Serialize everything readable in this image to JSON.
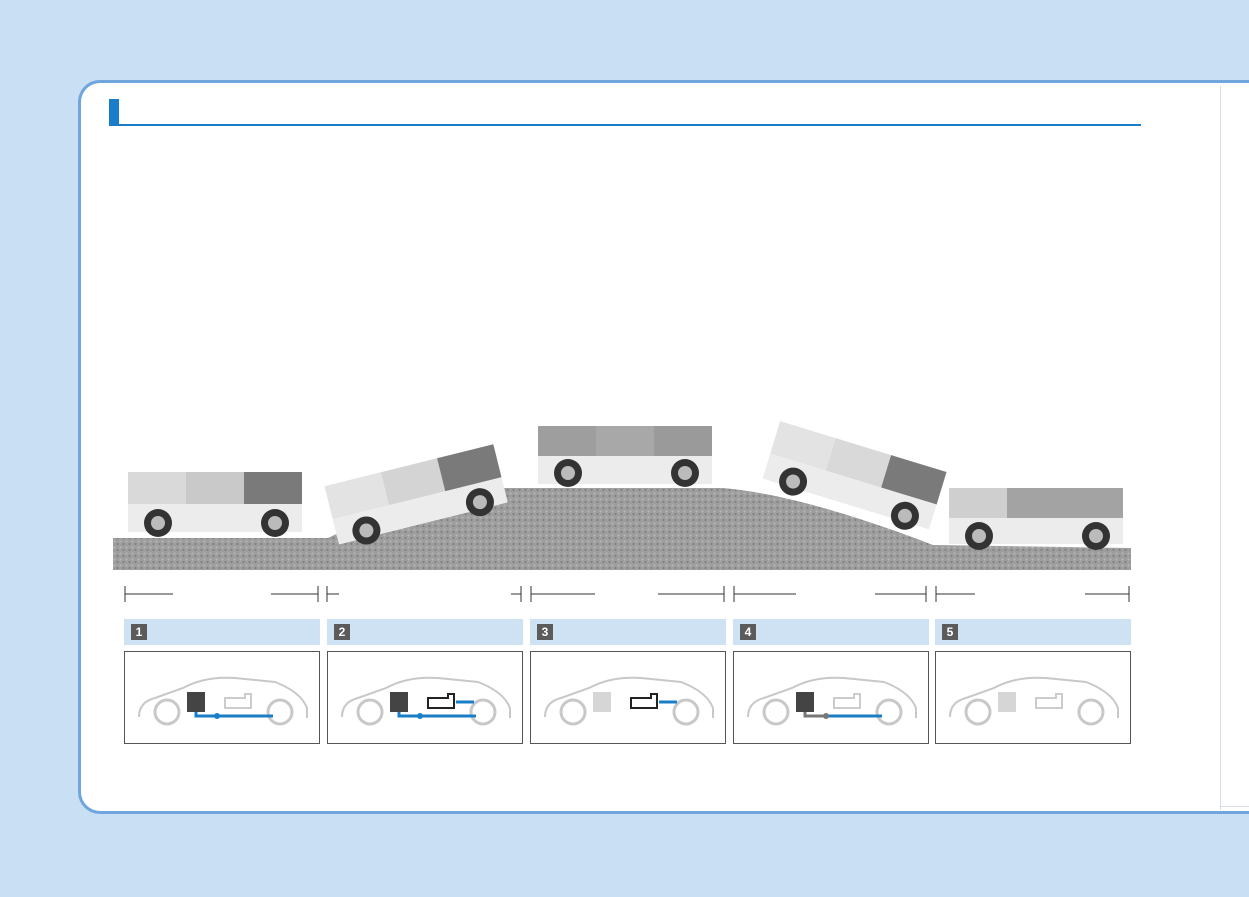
{
  "document": {
    "colors": {
      "background": "#c9dff3",
      "accent": "#1a7dc8",
      "page_border": "#6fa6de"
    }
  },
  "stages": [
    {
      "number": "1",
      "battery": "active",
      "engine": "inactive",
      "flow": "battery"
    },
    {
      "number": "2",
      "battery": "active",
      "engine": "active",
      "flow": "battery+engine"
    },
    {
      "number": "3",
      "battery": "inactive",
      "engine": "active",
      "flow": "engine"
    },
    {
      "number": "4",
      "battery": "active",
      "engine": "inactive",
      "flow": "regen"
    },
    {
      "number": "5",
      "battery": "inactive",
      "engine": "inactive",
      "flow": "none"
    }
  ]
}
